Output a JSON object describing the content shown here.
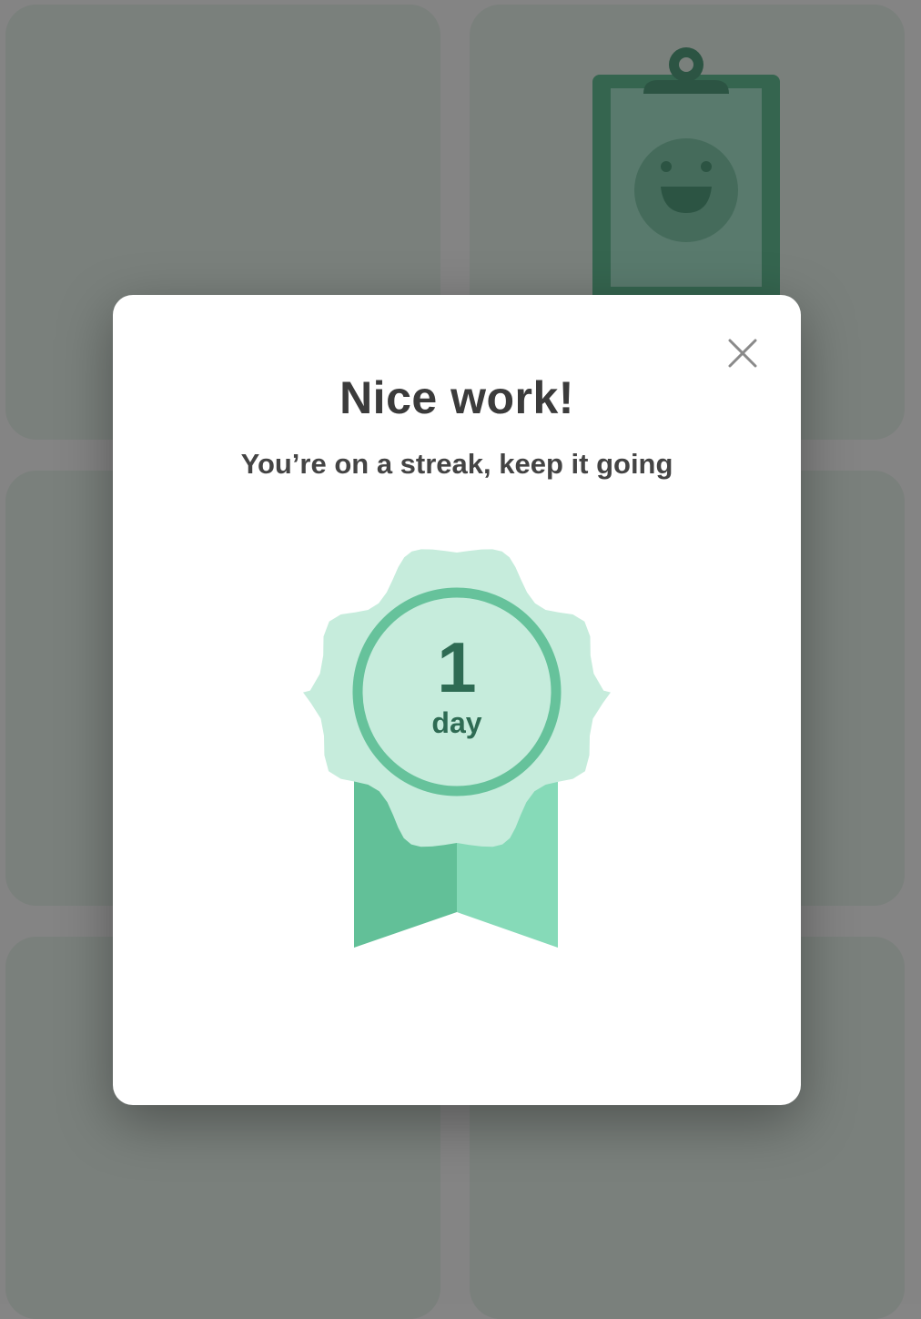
{
  "modal": {
    "title": "Nice work!",
    "subtitle": "You’re on a streak, keep it going",
    "close_icon": "close-icon",
    "badge": {
      "value": "1",
      "unit": "day",
      "icon": "award-ribbon-badge"
    }
  },
  "background": {
    "illustration": "clipboard-smiley-icon"
  },
  "colors": {
    "overlay": "#848484",
    "badge_light": "#c6ecdc",
    "badge_ring": "#66c29b",
    "ribbon_dark": "#62c098",
    "ribbon_light": "#86dab8",
    "badge_text": "#2e6b53",
    "title_text": "#3b3b3b"
  }
}
